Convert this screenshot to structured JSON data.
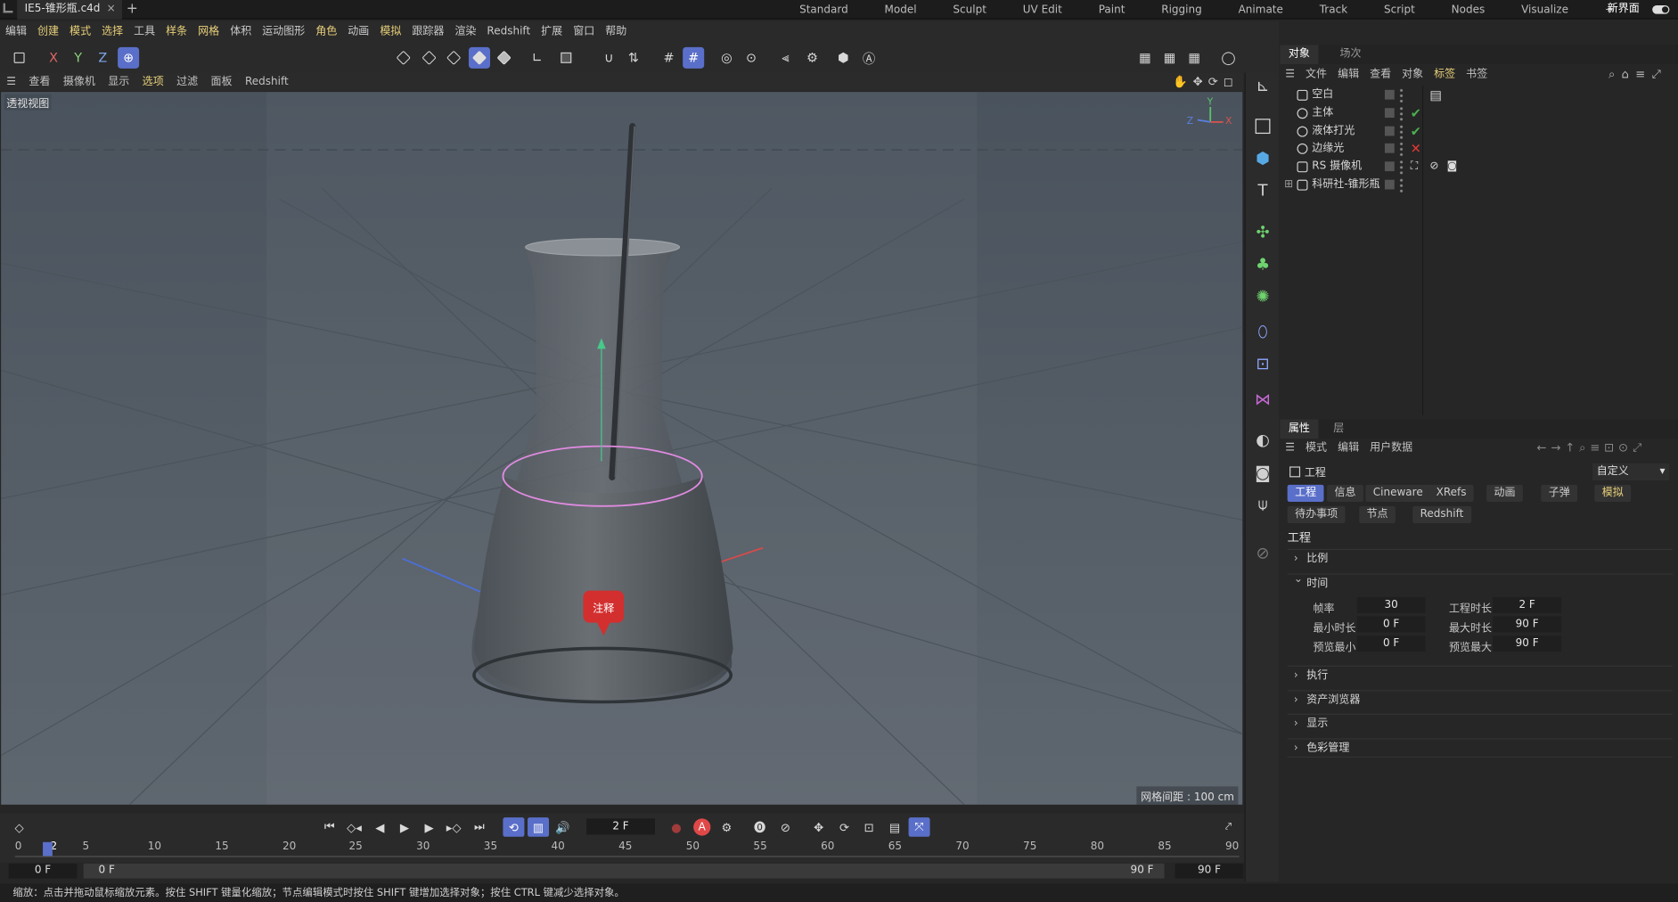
{
  "top": {
    "file_tab": "IE5-锥形瓶.c4d",
    "close": "×",
    "add": "+",
    "layouts": [
      "Standard",
      "Model",
      "Sculpt",
      "UV Edit",
      "Paint",
      "Rigging",
      "Animate",
      "Track",
      "Script",
      "Nodes",
      "Visualize",
      "+"
    ],
    "new_layout": "新界面"
  },
  "menu": [
    "编辑",
    "创建",
    "模式",
    "选择",
    "工具",
    "样条",
    "网格",
    "体积",
    "运动图形",
    "角色",
    "动画",
    "模拟",
    "跟踪器",
    "渲染",
    "Redshift",
    "扩展",
    "窗口",
    "帮助"
  ],
  "axis": {
    "x": "X",
    "y": "Y",
    "z": "Z"
  },
  "viewport": {
    "menu": [
      "查看",
      "摄像机",
      "显示",
      "选项",
      "过滤",
      "面板",
      "Redshift"
    ],
    "label": "透视视图",
    "grid_info": "网格间距 : 100 cm",
    "note": "注释",
    "gizmo": {
      "x": "X",
      "y": "Y",
      "z": "Z"
    }
  },
  "object_manager": {
    "tabs": [
      "对象",
      "场次"
    ],
    "menu": [
      "文件",
      "编辑",
      "查看",
      "对象",
      "标签",
      "书签"
    ],
    "rows": [
      {
        "name": "空白",
        "tag": ""
      },
      {
        "name": "主体",
        "tag": "✔"
      },
      {
        "name": "液体打光",
        "tag": "✔"
      },
      {
        "name": "边缘光",
        "tag": "✕"
      },
      {
        "name": "RS 摄像机",
        "tag": ""
      },
      {
        "name": "科研社-锥形瓶",
        "tag": ""
      }
    ]
  },
  "attributes": {
    "tabs": [
      "属性",
      "层"
    ],
    "menu": [
      "模式",
      "编辑",
      "用户数据"
    ],
    "project": "工程",
    "preset": "自定义",
    "tabs_row1": [
      "工程",
      "信息",
      "Cineware",
      "XRefs",
      "动画",
      "子弹",
      "模拟"
    ],
    "tabs_row2": [
      "待办事项",
      "节点",
      "Redshift"
    ],
    "section": "工程",
    "groups": [
      "比例",
      "时间",
      "执行",
      "资产浏览器",
      "显示",
      "色彩管理"
    ],
    "fields": {
      "fps_label": "帧率",
      "fps": "30",
      "length_label": "工程时长",
      "length": "2 F",
      "min_label": "最小时长",
      "min": "0 F",
      "max_label": "最大时长",
      "max": "90 F",
      "pmin_label": "预览最小",
      "pmin": "0 F",
      "pmax_label": "预览最大",
      "pmax": "90 F"
    }
  },
  "timeline": {
    "current_frame": "2 F",
    "ticks": [
      "0",
      "2",
      "5",
      "10",
      "15",
      "20",
      "25",
      "30",
      "35",
      "40",
      "45",
      "50",
      "55",
      "60",
      "65",
      "70",
      "75",
      "80",
      "85",
      "90"
    ],
    "range_start": "0 F",
    "range_a": "0 F",
    "range_b": "90 F",
    "range_end": "90 F",
    "record_label": "A"
  },
  "status": "缩放：点击并拖动鼠标缩放元素。按住 SHIFT 键量化缩放；节点编辑模式时按住 SHIFT 键增加选择对象；按住 CTRL 键减少选择对象。",
  "colors": {
    "accent": "#5a6fc9",
    "note": "#d32f2f",
    "check": "#4caf50",
    "cross": "#e53935"
  }
}
